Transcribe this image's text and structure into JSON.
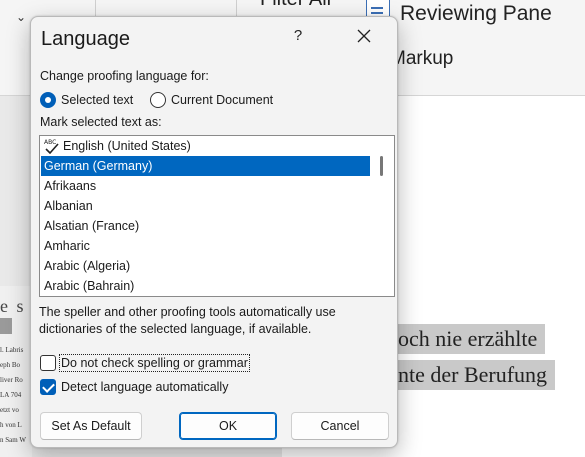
{
  "background": {
    "ribbon": {
      "filter_fragment": "Filter All",
      "reviewing_pane": "Reviewing Pane",
      "markup": "Markup"
    },
    "document": {
      "line1": "och nie erzählte",
      "line2": "nte der Berufung",
      "left_heading_fragment": "e s s",
      "left_lines": [
        "l. Labris",
        "eph Bo",
        "liver Ro",
        "LA 704",
        "etzt vo",
        "h von L",
        "n Sam W"
      ]
    }
  },
  "dialog": {
    "title": "Language",
    "help_label": "?",
    "proofing_label": "Change proofing language for:",
    "scope_options": [
      {
        "label": "Selected text",
        "selected": true
      },
      {
        "label": "Current Document",
        "selected": false
      }
    ],
    "mark_label": "Mark selected text as:",
    "languages": [
      {
        "label": "English (United States)",
        "has_spell_icon": true,
        "selected": false
      },
      {
        "label": "German (Germany)",
        "has_spell_icon": false,
        "selected": true
      },
      {
        "label": "Afrikaans",
        "has_spell_icon": false,
        "selected": false
      },
      {
        "label": "Albanian",
        "has_spell_icon": false,
        "selected": false
      },
      {
        "label": "Alsatian (France)",
        "has_spell_icon": false,
        "selected": false
      },
      {
        "label": "Amharic",
        "has_spell_icon": false,
        "selected": false
      },
      {
        "label": "Arabic (Algeria)",
        "has_spell_icon": false,
        "selected": false
      },
      {
        "label": "Arabic (Bahrain)",
        "has_spell_icon": false,
        "selected": false
      }
    ],
    "info_text": "The speller and other proofing tools automatically use dictionaries of the selected language, if available.",
    "options": [
      {
        "label": "Do not check spelling or grammar",
        "checked": false
      },
      {
        "label": "Detect language automatically",
        "checked": true
      }
    ],
    "buttons": {
      "set_default": "Set As Default",
      "ok": "OK",
      "cancel": "Cancel"
    }
  },
  "colors": {
    "accent": "#0067c0",
    "selection": "#0067c0",
    "dialog_bg": "#f3f3f3"
  }
}
